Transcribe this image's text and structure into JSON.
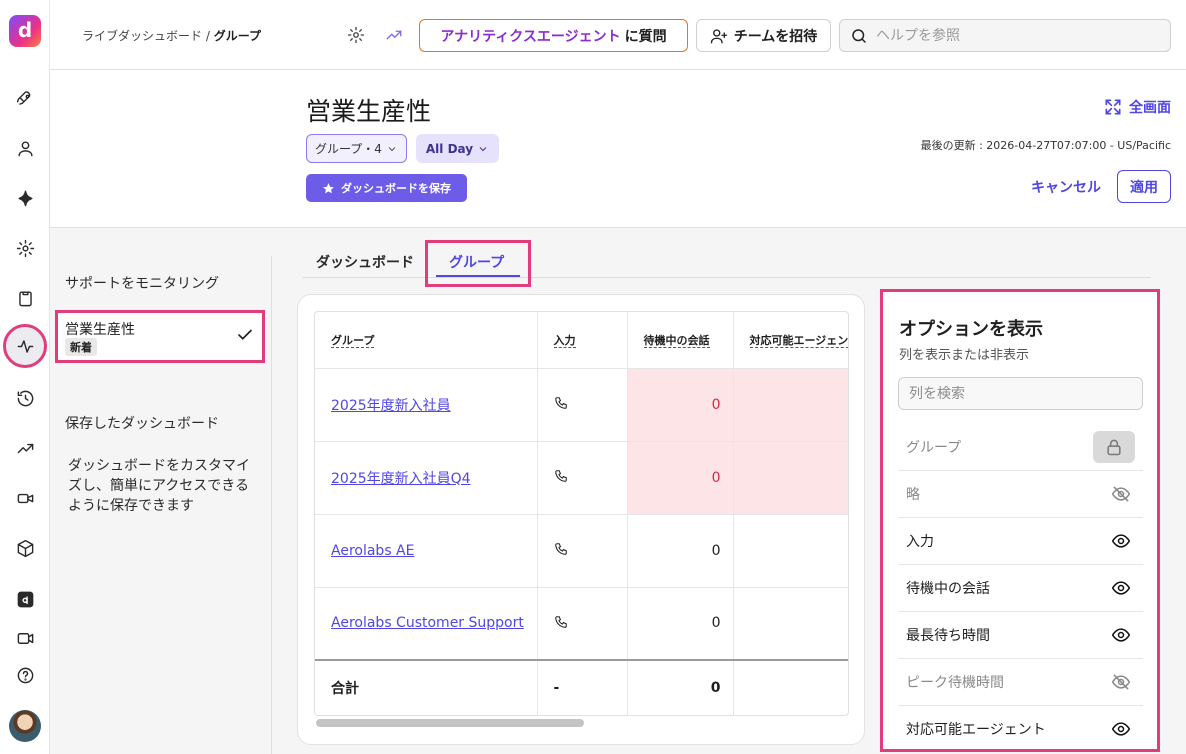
{
  "breadcrumb": {
    "parent": "ライブダッシュボード",
    "separator": "/",
    "current": "グループ"
  },
  "topbar": {
    "agent_button": {
      "prefix": "アナリティクスエージェント",
      "suffix": "に質問"
    },
    "invite_button": "チームを招待",
    "search_placeholder": "ヘルプを参照"
  },
  "header": {
    "title": "営業生産性",
    "filter_group": "グループ・4",
    "filter_time": "All Day",
    "save_button": "ダッシュボードを保存",
    "fullscreen": "全画面",
    "last_updated": "最後の更新 : 2026-04-27T07:07:00 - US/Pacific",
    "cancel": "キャンセル",
    "apply": "適用"
  },
  "left_panel": {
    "monitoring": "サポートをモニタリング",
    "selected": {
      "name": "営業生産性",
      "badge": "新着"
    },
    "saved_title": "保存したダッシュボード",
    "saved_desc": "ダッシュボードをカスタマイズし、簡単にアクセスできるように保存できます"
  },
  "tabs": {
    "dashboard": "ダッシュボード",
    "group": "グループ"
  },
  "table": {
    "headers": [
      "グループ",
      "入力",
      "待機中の会話",
      "対応可能エージェント"
    ],
    "rows": [
      {
        "group": "2025年度新入社員",
        "waiting": "0",
        "highlight": true
      },
      {
        "group": "2025年度新入社員Q4",
        "waiting": "0",
        "highlight": true
      },
      {
        "group": "Aerolabs AE",
        "waiting": "0",
        "highlight": false
      },
      {
        "group": "Aerolabs Customer Support",
        "waiting": "0",
        "highlight": false
      }
    ],
    "total": {
      "label": "合計",
      "input": "-",
      "waiting": "0"
    }
  },
  "options": {
    "title": "オプションを表示",
    "subtitle": "列を表示または非表示",
    "search_placeholder": "列を検索",
    "rows": [
      {
        "label": "グループ",
        "state": "locked"
      },
      {
        "label": "略",
        "state": "hidden"
      },
      {
        "label": "入力",
        "state": "visible"
      },
      {
        "label": "待機中の会話",
        "state": "visible"
      },
      {
        "label": "最長待ち時間",
        "state": "visible"
      },
      {
        "label": "ピーク待機時間",
        "state": "hidden"
      },
      {
        "label": "対応可能エージェント",
        "state": "visible"
      }
    ]
  },
  "colors": {
    "accent": "#4f46e5",
    "highlight_border": "#e13d7c",
    "negative_cell": "#fde5e7"
  }
}
